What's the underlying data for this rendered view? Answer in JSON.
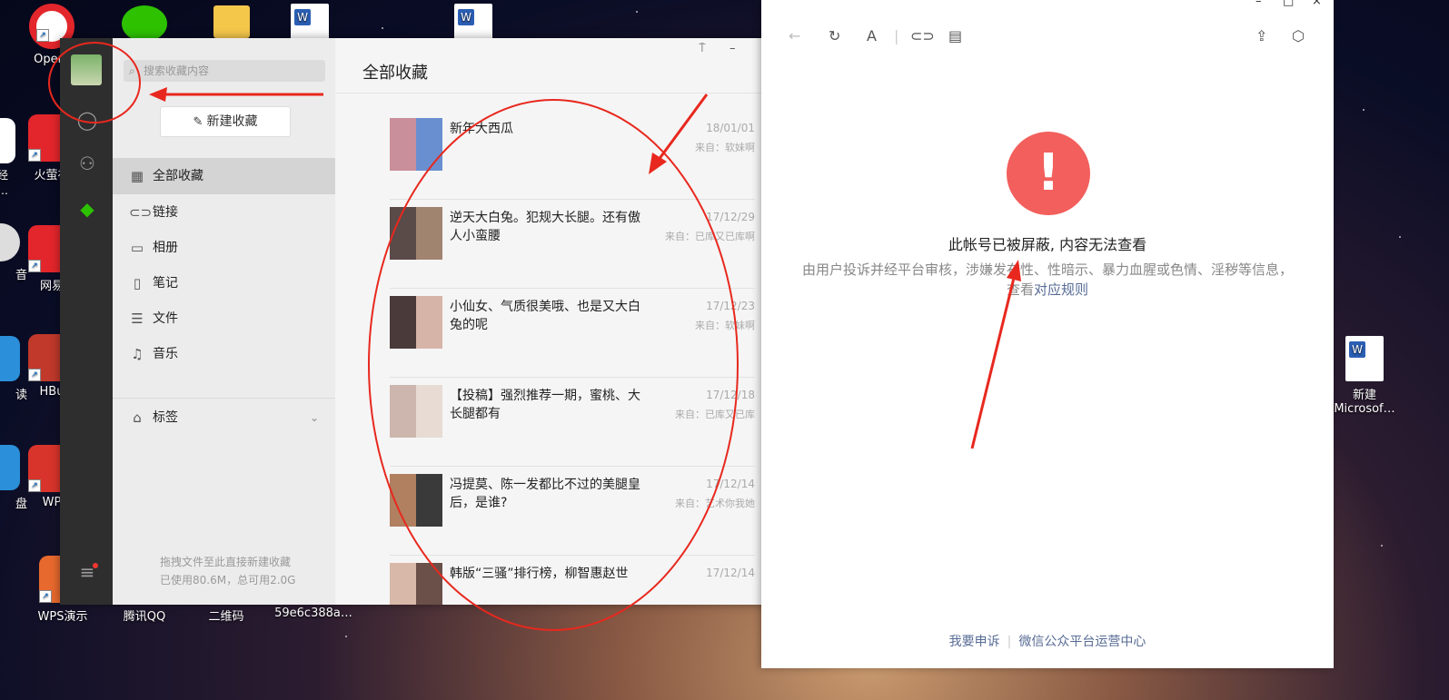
{
  "desktop": {
    "icons": [
      {
        "label": "Opera",
        "color": "#e3262b"
      },
      {
        "label": "财经\n年…",
        "color": "#ffffff"
      },
      {
        "label": "火萤视",
        "color": "#e3262b"
      },
      {
        "label": "网易",
        "color": "#e3262b"
      },
      {
        "label": "HBu",
        "color": "#c0392b"
      },
      {
        "label": "WP",
        "color": "#d9342b"
      },
      {
        "label": "WPS演示",
        "color": "#e8692d"
      },
      {
        "label": "腾讯QQ",
        "color": "#ffffff"
      },
      {
        "label": "二维码",
        "color": "#ffffff"
      },
      {
        "label": "59e6c388a…",
        "color": "#ffffff"
      },
      {
        "label": "新建\nMicrosof…",
        "color": "#ffffff"
      },
      {
        "label": "音",
        "color": "#ffffff"
      },
      {
        "label": "读",
        "color": "#2b8fd9"
      },
      {
        "label": "盘",
        "color": "#2b8fd9"
      }
    ]
  },
  "favorites": {
    "search_placeholder": "搜索收藏内容",
    "new_button": "新建收藏",
    "nav": [
      {
        "label": "全部收藏",
        "icon": "grid-icon"
      },
      {
        "label": "链接",
        "icon": "link-icon"
      },
      {
        "label": "相册",
        "icon": "photo-icon"
      },
      {
        "label": "笔记",
        "icon": "note-icon"
      },
      {
        "label": "文件",
        "icon": "file-icon"
      },
      {
        "label": "音乐",
        "icon": "music-icon"
      }
    ],
    "tags_label": "标签",
    "footer_drag": "拖拽文件至此直接新建收藏",
    "footer_usage": "已使用80.6M，总可用2.0G",
    "main_title": "全部收藏",
    "items": [
      {
        "title": "新年大西瓜",
        "date": "18/01/01",
        "source": "来自：软妹啊"
      },
      {
        "title": "逆天大白兔。犯规大长腿。还有傲人小蛮腰",
        "date": "17/12/29",
        "source": "来自：已库又已库啊"
      },
      {
        "title": "小仙女、气质很美哦、也是又大白兔的呢",
        "date": "17/12/23",
        "source": "来自：软妹啊"
      },
      {
        "title": "【投稿】强烈推荐一期，蜜桃、大长腿都有",
        "date": "17/12/18",
        "source": "来自：已库又已库"
      },
      {
        "title": "冯提莫、陈一发都比不过的美腿皇后，是谁?",
        "date": "17/12/14",
        "source": "来自：艺术你我她"
      },
      {
        "title": "韩版“三骚”排行榜，柳智惠赵世",
        "date": "17/12/14",
        "source": ""
      }
    ]
  },
  "article": {
    "blocked_title": "此帐号已被屏蔽, 内容无法查看",
    "blocked_desc": "由用户投诉并经平台审核，涉嫌发布性、性暗示、暴力血腥或色情、淫秽等信息，",
    "see_prefix": "查看",
    "rule_link": "对应规则",
    "appeal_link": "我要申诉",
    "center_link": "微信公众平台运营中心",
    "alert_color": "#f25f5c"
  },
  "annotation_color": "#e8281e"
}
